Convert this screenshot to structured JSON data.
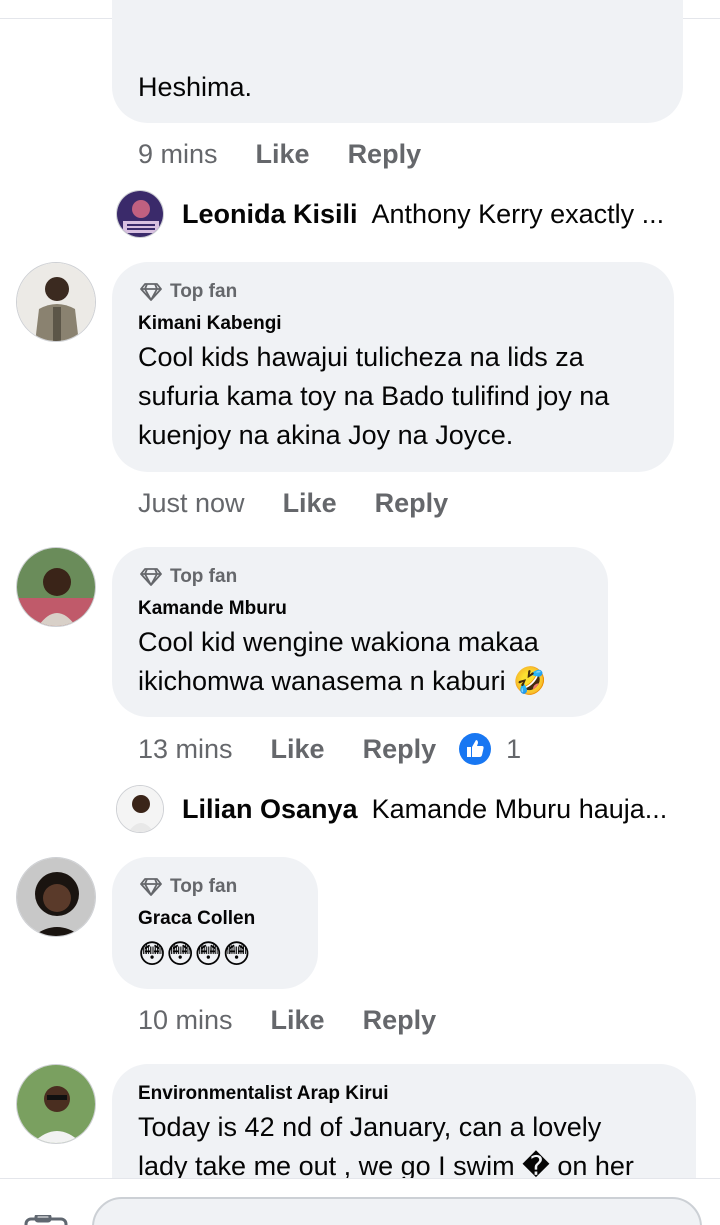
{
  "comments": [
    {
      "body": "Heshima.",
      "time": "9 mins",
      "like": "Like",
      "reply": "Reply"
    },
    {
      "badge": "Top fan",
      "author": "Kimani Kabengi",
      "body_lines": [
        "Cool kids hawajui tulicheza na lids za",
        "sufuria kama toy na Bado tulifind joy na",
        "kuenjoy na akina Joy na Joyce."
      ],
      "time": "Just now",
      "like": "Like",
      "reply": "Reply"
    },
    {
      "badge": "Top fan",
      "author": "Kamande Mburu",
      "body_lines": [
        "Cool kid wengine wakiona makaa",
        "ikichomwa wanasema n kaburi 🤣"
      ],
      "time": "13 mins",
      "like": "Like",
      "reply": "Reply",
      "reaction_count": "1"
    },
    {
      "badge": "Top fan",
      "author": "Graca Collen",
      "body": "😳😳😳😳",
      "time": "10 mins",
      "like": "Like",
      "reply": "Reply"
    },
    {
      "author": "Environmentalist Arap Kirui",
      "body_lines": [
        "Today is 42 nd  of January, can a lovely",
        "lady take me out , we  go I swim � on her"
      ]
    }
  ],
  "replies": [
    {
      "name": "Leonida Kisili",
      "text": "Anthony Kerry exactly  ..."
    },
    {
      "name": "Lilian Osanya",
      "text": "Kamande Mburu hauja..."
    }
  ],
  "colors": {
    "bubble": "#f0f2f5",
    "meta": "#65676b",
    "like_blue": "#1877f2"
  }
}
